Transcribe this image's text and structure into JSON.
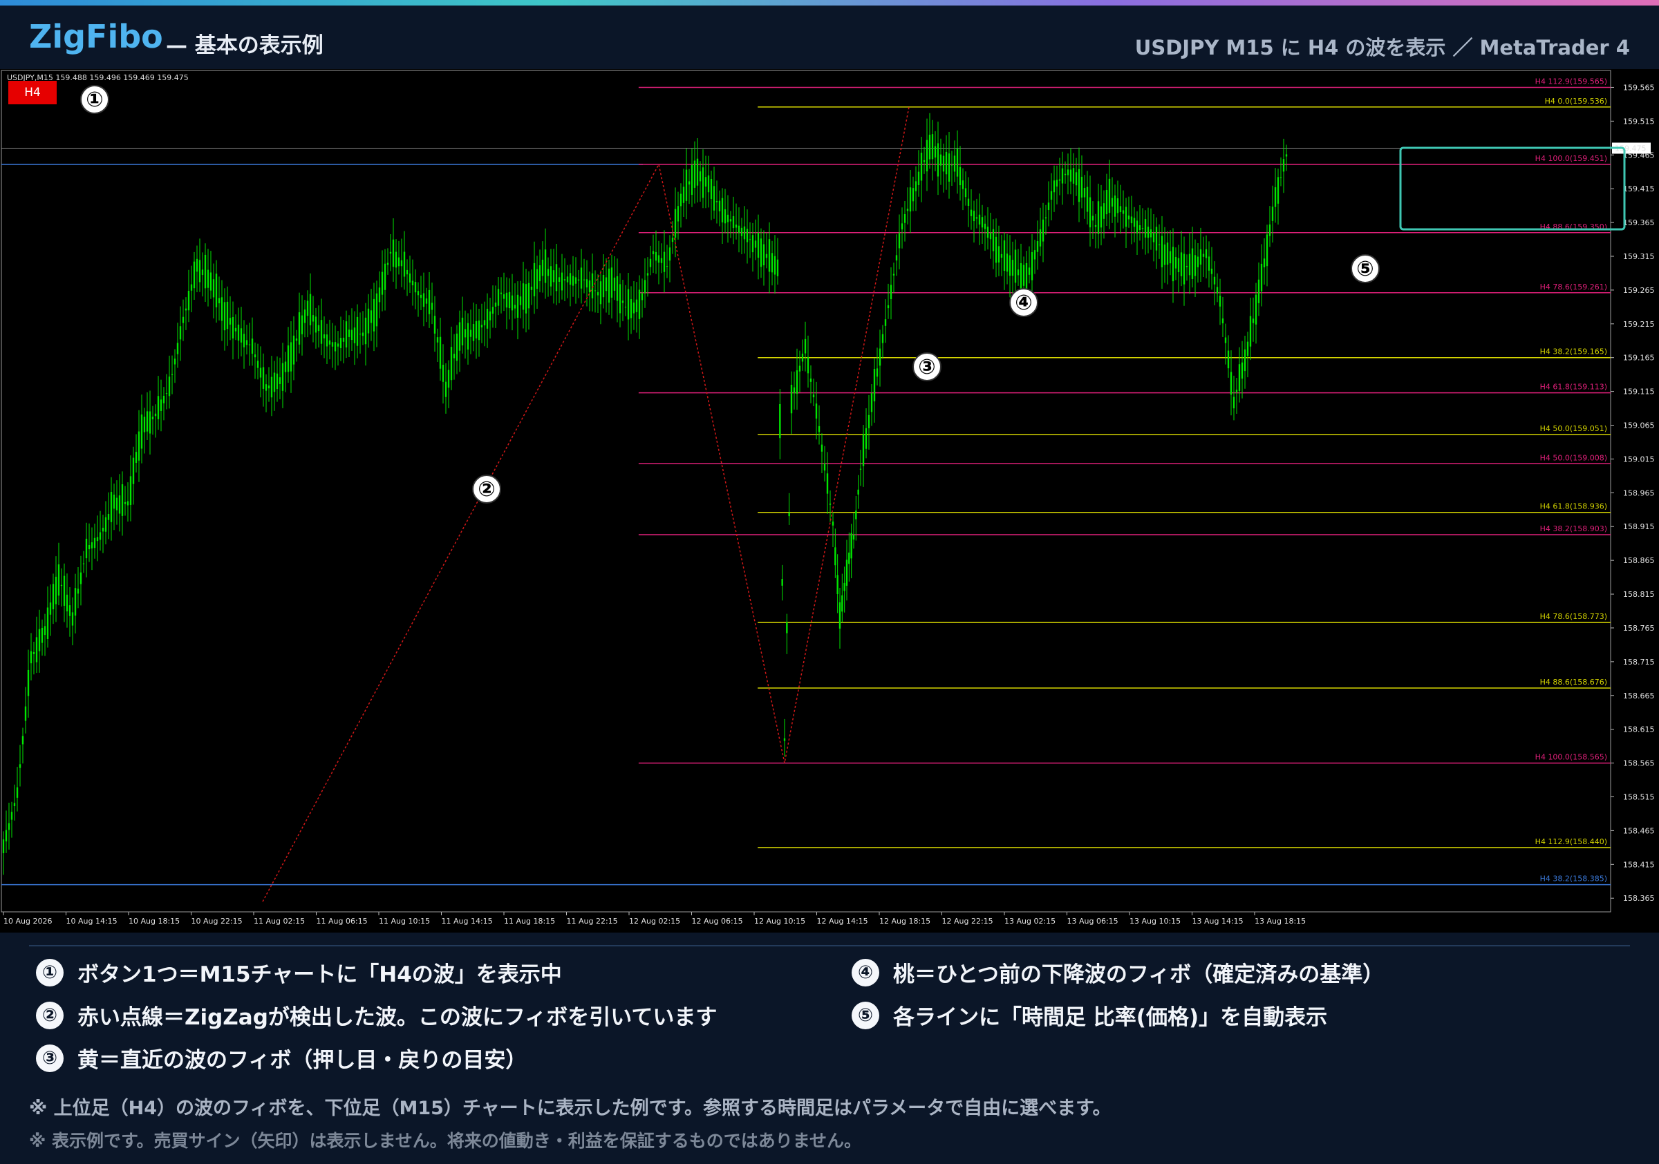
{
  "header": {
    "brand": "ZigFibo",
    "subtitle": "— 基本の表示例",
    "right": "USDJPY M15 に H4 の波を表示 ／ MetaTrader 4"
  },
  "chart": {
    "symbol_line": "USDJPY,M15  159.488 159.496 159.469 159.475",
    "h4_button": "H4",
    "current_price": "159.475",
    "price_min": 158.365,
    "price_max": 159.6,
    "price_ticks": [
      "159.565",
      "159.515",
      "159.465",
      "159.415",
      "159.365",
      "159.315",
      "159.265",
      "159.215",
      "159.165",
      "159.115",
      "159.065",
      "159.015",
      "158.965",
      "158.915",
      "158.865",
      "158.815",
      "158.765",
      "158.715",
      "158.665",
      "158.615",
      "158.565",
      "158.515",
      "158.465",
      "158.415",
      "158.365"
    ],
    "time_ticks": [
      "10 Aug 2026",
      "10 Aug 14:15",
      "10 Aug 18:15",
      "10 Aug 22:15",
      "11 Aug 02:15",
      "11 Aug 06:15",
      "11 Aug 10:15",
      "11 Aug 14:15",
      "11 Aug 18:15",
      "11 Aug 22:15",
      "12 Aug 02:15",
      "12 Aug 06:15",
      "12 Aug 10:15",
      "12 Aug 14:15",
      "12 Aug 18:15",
      "12 Aug 22:15",
      "13 Aug 02:15",
      "13 Aug 06:15",
      "13 Aug 10:15",
      "13 Aug 14:15",
      "13 Aug 18:15"
    ],
    "colors": {
      "bg": "#000000",
      "candle": "#00e600",
      "yellow": "#d4d400",
      "pink": "#e0207a",
      "blue": "#3a78d8",
      "zigzag": "#d01818",
      "highlight": "#3fc7b3"
    },
    "fib_levels": [
      {
        "price": 159.565,
        "label": "H4 112.9(159.565)",
        "color": "pink",
        "start": 0.396
      },
      {
        "price": 159.536,
        "label": "H4 0.0(159.536)",
        "color": "yellow",
        "start": 0.47
      },
      {
        "price": 159.451,
        "label": "H4 100.0(159.451)",
        "color": "pink",
        "start": 0.396
      },
      {
        "price": 159.35,
        "label": "H4 88.6(159.350)",
        "color": "pink",
        "start": 0.396
      },
      {
        "price": 159.261,
        "label": "H4 78.6(159.261)",
        "color": "pink",
        "start": 0.396
      },
      {
        "price": 159.165,
        "label": "H4 38.2(159.165)",
        "color": "yellow",
        "start": 0.47
      },
      {
        "price": 159.113,
        "label": "H4 61.8(159.113)",
        "color": "pink",
        "start": 0.396
      },
      {
        "price": 159.051,
        "label": "H4 50.0(159.051)",
        "color": "yellow",
        "start": 0.47
      },
      {
        "price": 159.008,
        "label": "H4 50.0(159.008)",
        "color": "pink",
        "start": 0.396
      },
      {
        "price": 158.936,
        "label": "H4 61.8(158.936)",
        "color": "yellow",
        "start": 0.47
      },
      {
        "price": 158.903,
        "label": "H4 38.2(158.903)",
        "color": "pink",
        "start": 0.396
      },
      {
        "price": 158.773,
        "label": "H4 78.6(158.773)",
        "color": "yellow",
        "start": 0.47
      },
      {
        "price": 158.676,
        "label": "H4 88.6(158.676)",
        "color": "yellow",
        "start": 0.47
      },
      {
        "price": 158.565,
        "label": "H4 100.0(158.565)",
        "color": "pink",
        "start": 0.396
      },
      {
        "price": 158.44,
        "label": "H4 112.9(158.440)",
        "color": "yellow",
        "start": 0.47
      },
      {
        "price": 158.385,
        "label": "H4 38.2(158.385)",
        "color": "blue",
        "start": 0.0
      }
    ],
    "markers": [
      "①",
      "②",
      "③",
      "④",
      "⑤"
    ]
  },
  "legend": [
    {
      "num": "①",
      "text": "ボタン1つ＝M15チャートに「H4の波」を表示中"
    },
    {
      "num": "②",
      "text": "赤い点線＝ZigZagが検出した波。この波にフィボを引いています"
    },
    {
      "num": "③",
      "text": "黄＝直近の波のフィボ（押し目・戻りの目安）"
    },
    {
      "num": "④",
      "text": "桃＝ひとつ前の下降波のフィボ（確定済みの基準）"
    },
    {
      "num": "⑤",
      "text": "各ラインに「時間足 比率(価格)」を自動表示"
    }
  ],
  "notes": [
    "※ 上位足（H4）の波のフィボを、下位足（M15）チャートに表示した例です。参照する時間足はパラメータで自由に選べます。",
    "※ 表示例です。売買サイン（矢印）は表示しません。将来の値動き・利益を保証するものではありません。"
  ]
}
